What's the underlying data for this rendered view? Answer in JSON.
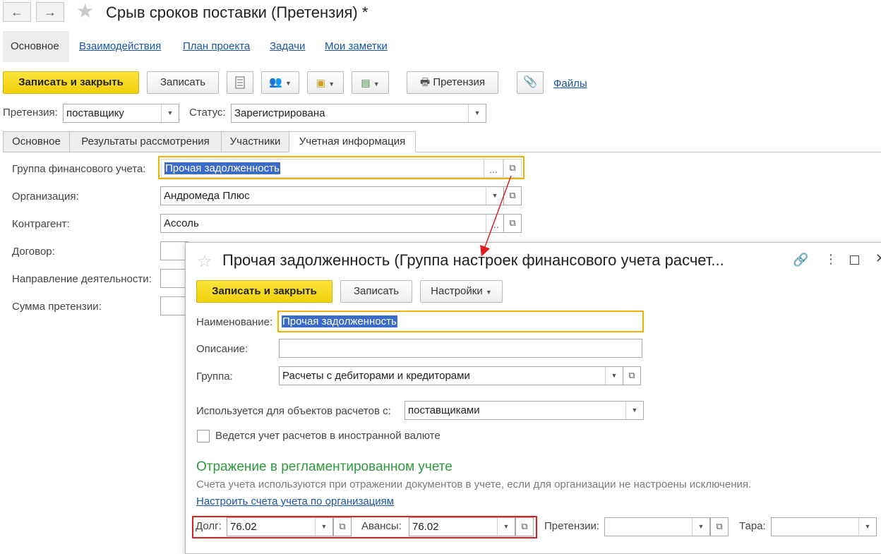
{
  "window": {
    "title": "Срыв сроков поставки (Претензия) *",
    "back_icon": "←",
    "forward_icon": "→"
  },
  "top_tabs": [
    "Основное",
    "Взаимодействия",
    "План проекта",
    "Задачи",
    "Мои заметки"
  ],
  "toolbar": {
    "save_close": "Записать и закрыть",
    "save": "Записать",
    "print_label": "Претензия",
    "files_label": "Файлы"
  },
  "header_fields": {
    "claim_label": "Претензия:",
    "claim_value": "поставщику",
    "status_label": "Статус:",
    "status_value": "Зарегистрирована"
  },
  "inner_tabs": [
    "Основное",
    "Результаты рассмотрения",
    "Участники",
    "Учетная информация"
  ],
  "form": {
    "fin_group_label": "Группа финансового учета:",
    "fin_group_value": "Прочая задолженность",
    "ellipsis": "...",
    "org_label": "Организация:",
    "org_value": "Андромеда Плюс",
    "counterparty_label": "Контрагент:",
    "counterparty_value": "Ассоль",
    "contract_label": "Договор:",
    "direction_label": "Направление деятельности:",
    "amount_label": "Сумма претензии:"
  },
  "dialog": {
    "title": "Прочая задолженность (Группа настроек финансового учета расчет...",
    "save_close": "Записать и закрыть",
    "save": "Записать",
    "settings": "Настройки",
    "name_label": "Наименование:",
    "name_value": "Прочая задолженность",
    "desc_label": "Описание:",
    "group_label": "Группа:",
    "group_value": "Расчеты с дебиторами и кредиторами",
    "used_for_label": "Используется для объектов расчетов с:",
    "used_for_value": "поставщиками",
    "foreign_currency_label": "Ведется учет расчетов в иностранной валюте",
    "section_title": "Отражение в регламентированном учете",
    "hint": "Счета учета используются при отражении документов в учете, если для организации не настроены исключения.",
    "configure_link": "Настроить счета учета по организациям",
    "debt_label": "Долг:",
    "debt_value": "76.02",
    "advances_label": "Авансы:",
    "advances_value": "76.02",
    "claims_label": "Претензии:",
    "tare_label": "Тара:"
  },
  "colors": {
    "accent_yellow": "#f5d51a",
    "highlight_border": "#f0b400",
    "annotation_red": "#e02020",
    "link_blue": "#1a57a8",
    "section_green": "#2d9a3b",
    "selection_blue": "#3b6bc9"
  }
}
